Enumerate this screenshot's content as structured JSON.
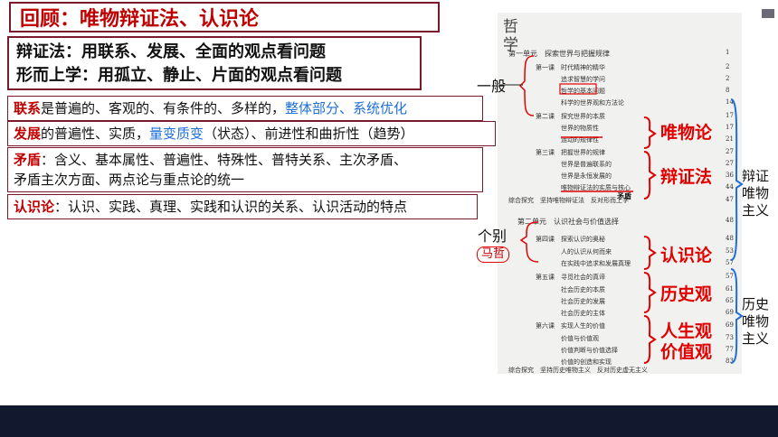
{
  "title": "回顾：唯物辩证法、认识论",
  "definitions": {
    "dialectics": "辩证法：用联系、发展、全面的观点看问题",
    "metaphysics": "形而上学：用孤立、静止、片面的观点看问题"
  },
  "rows": {
    "connection": {
      "kw": "联系",
      "text": "是普遍的、客观的、有条件的、多样的，",
      "blue": "整体部分、系统优化"
    },
    "development": {
      "kw": "发展",
      "text1": "的普遍性、实质，",
      "blue": "量变质变",
      "text2": "（状态）、前进性和曲折性（趋势）"
    },
    "contradiction": {
      "kw": "矛盾",
      "line1": "：含义、基本属性、普遍性、特殊性、普特关系、主次矛盾、",
      "line2": "矛盾主次方面、两点论与重点论的统一"
    },
    "epistemology": {
      "kw": "认识论",
      "text": "：认识、实践、真理、实践和认识的关系、认识活动的特点"
    }
  },
  "book": {
    "header": "哲\n学",
    "unit1": "第一单元　探索世界与把握规律",
    "lesson1": "第一课　时代精神的精华",
    "l1a": "追求智慧的学问",
    "l1b": "哲学的基本问题",
    "l1c": "科学的世界观和方法论",
    "lesson2": "第二课　探究世界的本质",
    "l2a": "世界的物质性",
    "l2b": "运动的规律性",
    "lesson3": "第三课　把握世界的规律",
    "l3a": "世界是普遍联系的",
    "l3b": "世界是永恒发展的",
    "l3c": "唯物辩证法的实质与核心",
    "inquiry1": "综合探究　坚持唯物辩证法　反对形而上学",
    "unit2": "第二单元　认识社会与价值选择",
    "lesson4": "第四课　探索认识的奥秘",
    "l4a": "人的认识从何而来",
    "l4b": "在实践中追求和发展真理",
    "lesson5": "第五课　寻觅社会的真谛",
    "l5a": "社会历史的本质",
    "l5b": "社会历史的发展",
    "l5c": "社会历史的主体",
    "lesson6": "第六课　实现人生的价值",
    "l6a": "价值与价值观",
    "l6b": "价值判断与价值选择",
    "l6c": "价值的创造和实现",
    "inquiry2": "综合探究　坚持历史唯物主义　反对历史虚无主义",
    "pages": [
      "1",
      "2",
      "2",
      "8",
      "14",
      "17",
      "17",
      "21",
      "27",
      "27",
      "36",
      "44",
      "47",
      "48",
      "48",
      "53",
      "57",
      "57",
      "61",
      "65",
      "69",
      "69",
      "73",
      "77",
      "83"
    ],
    "annot_maodun": "矛盾"
  },
  "annotations": {
    "yiban": "一般",
    "gebie": "个别",
    "mazhe": "马哲",
    "weiwulun": "唯物论",
    "bianzhengfa": "辩证法",
    "renshilun": "认识论",
    "lishiguan": "历史观",
    "renshengguan": "人生观",
    "jiazhiguan": "价值观",
    "dialectical_materialism": "辩证\n唯物\n主义",
    "historical_materialism": "历史\n唯物\n主义"
  },
  "colors": {
    "accent_red": "#e00000",
    "border": "#7a1a2a",
    "blue": "#1e6fd9",
    "footer": "#12182e"
  }
}
